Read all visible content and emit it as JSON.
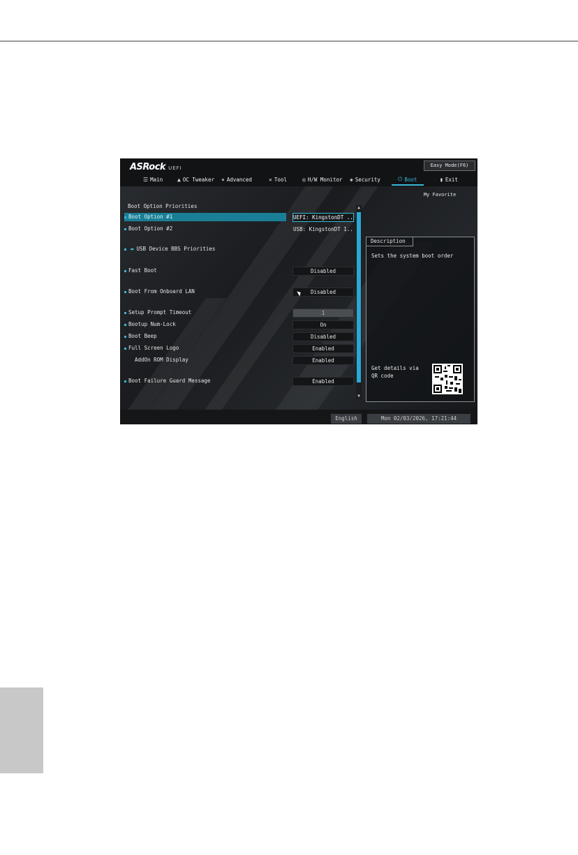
{
  "brand": {
    "name": "ASRock",
    "sub": "UEFI"
  },
  "header": {
    "easy_mode": "Easy Mode(F6)",
    "my_favorite": "My Favorite"
  },
  "nav": [
    {
      "label": "Main",
      "icon": "list-icon"
    },
    {
      "label": "OC Tweaker",
      "icon": "flame-icon"
    },
    {
      "label": "Advanced",
      "icon": "star-icon"
    },
    {
      "label": "Tool",
      "icon": "wrench-icon"
    },
    {
      "label": "H/W Monitor",
      "icon": "gauge-icon"
    },
    {
      "label": "Security",
      "icon": "shield-icon"
    },
    {
      "label": "Boot",
      "icon": "power-icon",
      "active": true
    },
    {
      "label": "Exit",
      "icon": "door-icon"
    }
  ],
  "section_title": "Boot Option Priorities",
  "options": [
    {
      "label": "Boot Option #1",
      "value": "UEFI: KingstonDT ..."
    },
    {
      "label": "Boot Option #2",
      "value": "USB: KingstonDT 1..."
    },
    {
      "label": "USB Device BBS Priorities",
      "value": ""
    },
    {
      "label": "Fast Boot",
      "value": "Disabled"
    },
    {
      "label": "Boot From Onboard LAN",
      "value": "Disabled"
    },
    {
      "label": "Setup Prompt Timeout",
      "value": "1"
    },
    {
      "label": "Bootup Num-Lock",
      "value": "On"
    },
    {
      "label": "Boot Beep",
      "value": "Disabled"
    },
    {
      "label": "Full Screen Logo",
      "value": "Enabled"
    },
    {
      "label": "AddOn ROM Display",
      "value": "Enabled"
    },
    {
      "label": "Boot Failure Guard Message",
      "value": "Enabled"
    }
  ],
  "description": {
    "title": "Description",
    "text": "Sets the system boot order",
    "qr_text": "Get details via QR code"
  },
  "footer": {
    "language": "English",
    "datetime": "Mon 02/03/2026, 17:21:44"
  },
  "colors": {
    "accent": "#3ab8d8",
    "selection": "#1a7f96"
  }
}
